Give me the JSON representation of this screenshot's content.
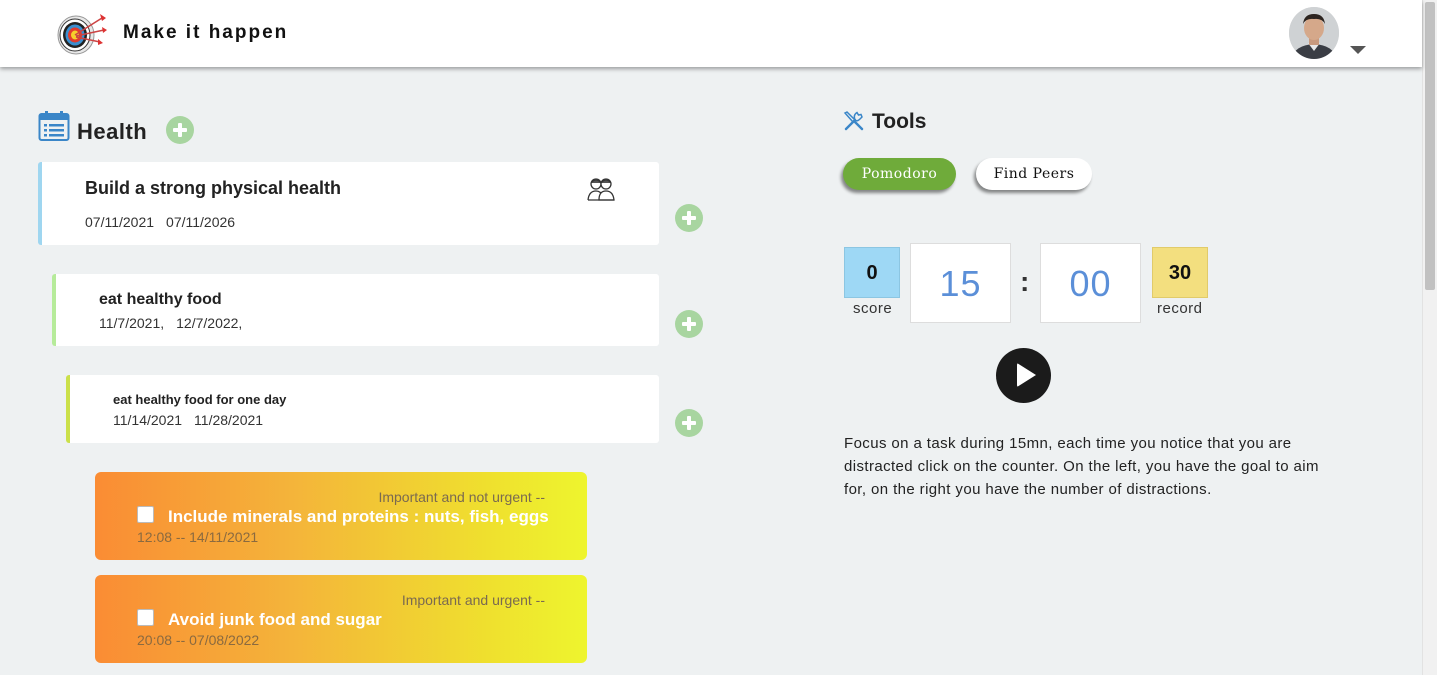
{
  "header": {
    "app_title": "Make it happen",
    "logo_icon": "archery-target-icon",
    "avatar_icon": "user-avatar-icon"
  },
  "section": {
    "title": "Health",
    "icon": "calendar-list-icon"
  },
  "goals": [
    {
      "title": "Build a strong physical health",
      "start": "07/11/2021",
      "end": "07/11/2026",
      "accent": "#9fd6f0",
      "peers_icon": "two-people-icon"
    },
    {
      "title": "eat healthy food",
      "start": "11/7/2021,",
      "end": "12/7/2022,",
      "accent": "#b6eb9a"
    },
    {
      "title": "eat healthy food for one day",
      "start": "11/14/2021",
      "end": "11/28/2021",
      "accent": "#cbe04a"
    }
  ],
  "tasks": [
    {
      "priority": "Important and not urgent --",
      "title": "Include minerals and proteins : nuts, fish, eggs",
      "time": "12:08 -- 14/11/2021"
    },
    {
      "priority": "Important and urgent --",
      "title": "Avoid junk food and sugar",
      "time": "20:08 -- 07/08/2022"
    }
  ],
  "tools": {
    "title": "Tools",
    "icon": "tools-icon",
    "buttons": {
      "pomodoro": "Pomodoro",
      "find_peers": "Find Peers"
    },
    "timer": {
      "score": "0",
      "score_label": "score",
      "minutes": "15",
      "separator": ":",
      "seconds": "00",
      "record": "30",
      "record_label": "record"
    },
    "description": "Focus on a task during 15mn, each time you notice that you are distracted click on the counter. On the left, you have the goal to aim for, on the right you have the number of distractions."
  },
  "colors": {
    "primary_green": "#6fab3a",
    "timer_blue": "#5b8fd8",
    "score_bg": "#9ed8f5",
    "record_bg": "#f3df7f"
  }
}
